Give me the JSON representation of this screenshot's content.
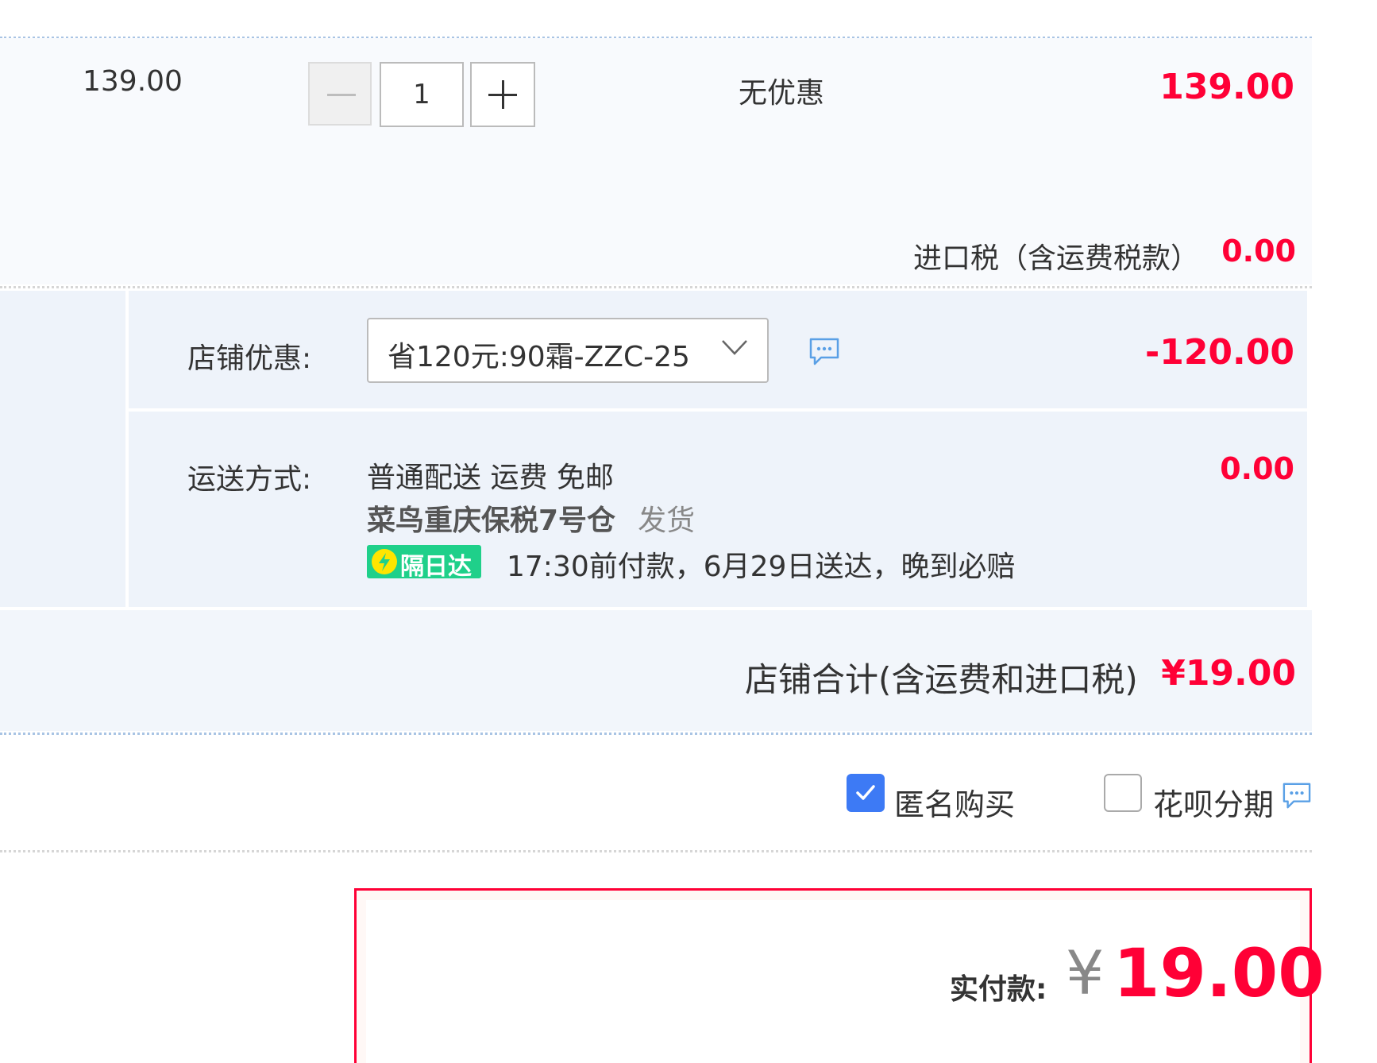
{
  "item": {
    "unit_price": "139.00",
    "quantity": "1",
    "promotion": "无优惠",
    "subtotal": "139.00",
    "tax_label": "进口税（含运费税款）",
    "tax_value": "0.00"
  },
  "store": {
    "coupon_label": "店铺优惠:",
    "coupon_selected": "省120元:90霜-ZZC-25",
    "coupon_discount": "-120.00",
    "shipping_label": "运送方式:",
    "shipping_method": "普通配送 运费 免邮",
    "warehouse": "菜鸟重庆保税7号仓",
    "warehouse_suffix": "发货",
    "badge_label": "隔日达",
    "delivery_note": "17:30前付款，6月29日送达，晚到必赔",
    "shipping_fee": "0.00",
    "total_label": "店铺合计(含运费和进口税)",
    "total_value": "¥19.00"
  },
  "options": {
    "anonymous_label": "匿名购买",
    "anonymous_checked": true,
    "huabei_label": "花呗分期",
    "huabei_checked": false
  },
  "payment": {
    "label": "实付款:",
    "currency": "¥",
    "amount": "19.00"
  },
  "colors": {
    "price_red": "#ff0036",
    "accent_blue": "#3d7af5",
    "badge_green": "#1fd08a",
    "panel_bg": "#eef3fa"
  },
  "icons": [
    "minus-icon",
    "plus-icon",
    "chevron-down-icon",
    "chat-bubble-icon",
    "checkmark-icon",
    "lightning-icon"
  ]
}
